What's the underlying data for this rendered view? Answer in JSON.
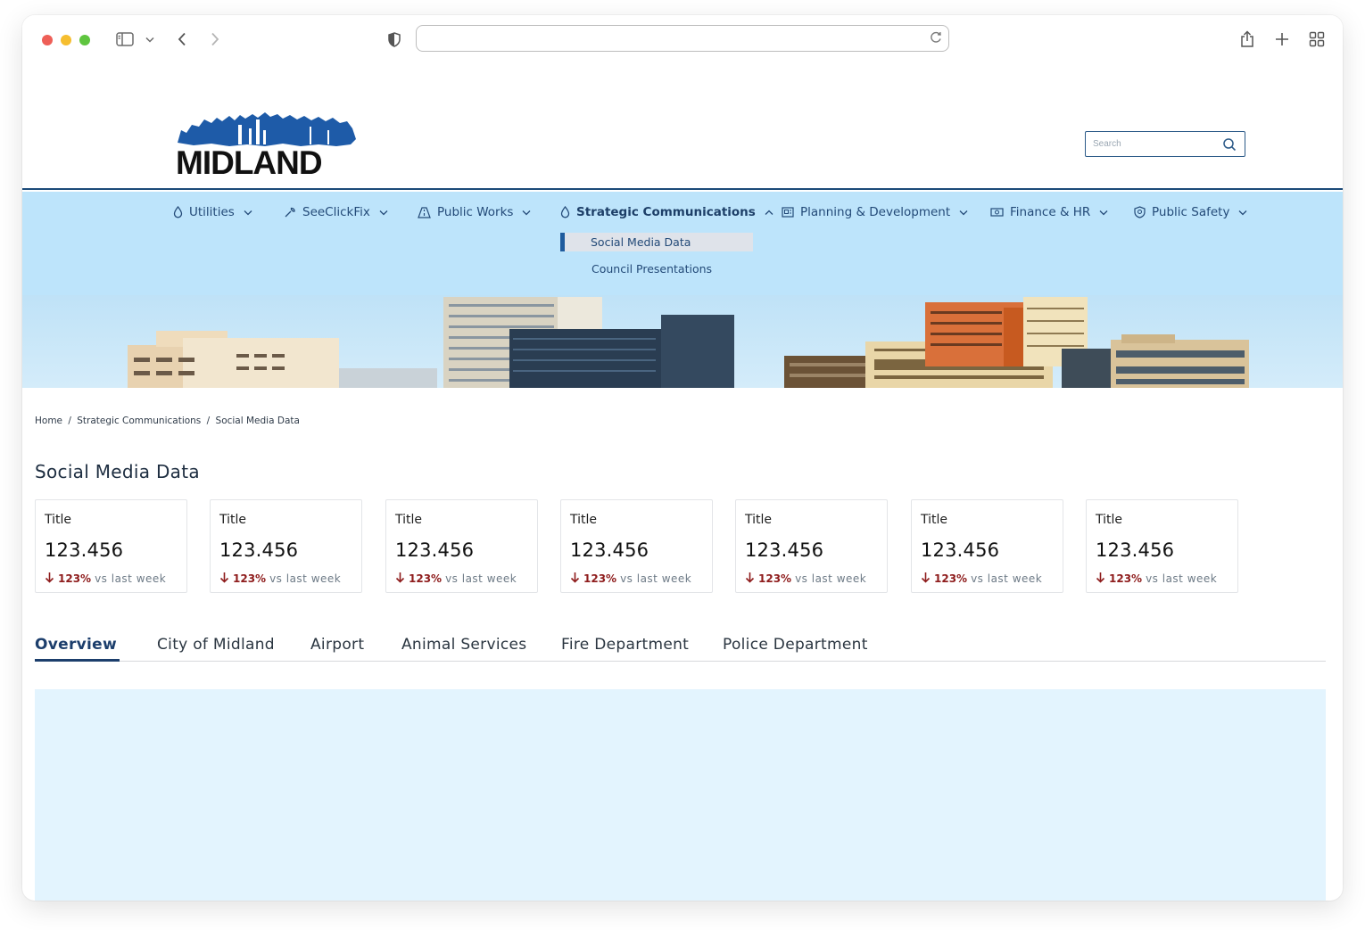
{
  "browser": {
    "url": "",
    "icons": [
      "sidebar-icon",
      "chevron-down-icon",
      "back-icon",
      "forward-icon",
      "shield-icon",
      "reload-icon",
      "share-icon",
      "new-tab-icon",
      "tab-overview-icon"
    ]
  },
  "header": {
    "logo_text": "MIDLAND",
    "search_placeholder": "Search"
  },
  "nav": {
    "items": [
      {
        "label": "Utilities",
        "icon": "water-drop-icon"
      },
      {
        "label": "SeeClickFix",
        "icon": "wrench-icon"
      },
      {
        "label": "Public Works",
        "icon": "road-icon"
      },
      {
        "label": "Strategic Communications",
        "icon": "water-drop-icon"
      },
      {
        "label": "Planning & Development",
        "icon": "blueprint-icon"
      },
      {
        "label": "Finance & HR",
        "icon": "cash-icon"
      },
      {
        "label": "Public Safety",
        "icon": "badge-icon"
      }
    ],
    "submenu": [
      "Social Media Data",
      "Council Presentations"
    ]
  },
  "breadcrumb": [
    "Home",
    "/",
    "Strategic Communications",
    "/",
    "Social Media Data"
  ],
  "page_title": "Social Media Data",
  "cards": [
    {
      "title": "Title",
      "value": "123.456",
      "delta": "123%",
      "compare": "vs last week"
    },
    {
      "title": "Title",
      "value": "123.456",
      "delta": "123%",
      "compare": "vs last week"
    },
    {
      "title": "Title",
      "value": "123.456",
      "delta": "123%",
      "compare": "vs last week"
    },
    {
      "title": "Title",
      "value": "123.456",
      "delta": "123%",
      "compare": "vs last week"
    },
    {
      "title": "Title",
      "value": "123.456",
      "delta": "123%",
      "compare": "vs last week"
    },
    {
      "title": "Title",
      "value": "123.456",
      "delta": "123%",
      "compare": "vs last week"
    },
    {
      "title": "Title",
      "value": "123.456",
      "delta": "123%",
      "compare": "vs last week"
    }
  ],
  "tabs": [
    "Overview",
    "City of Midland",
    "Airport",
    "Animal Services",
    "Fire Department",
    "Police Department"
  ],
  "colors": {
    "brand_blue": "#1c3e6c",
    "nav_band": "#bde4fb",
    "panel": "#e3f4fe",
    "negative": "#8e1c1c"
  }
}
